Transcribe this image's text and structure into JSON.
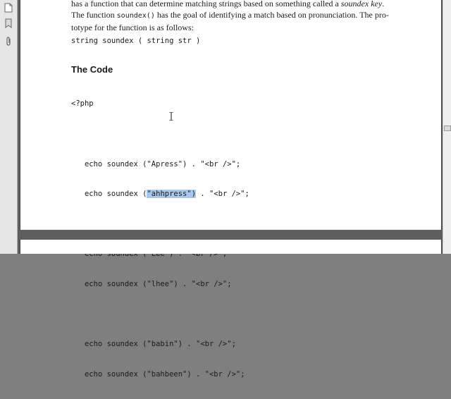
{
  "toolbar": {
    "icons": [
      "pages-icon",
      "bookmark-icon",
      "attachment-icon"
    ]
  },
  "document": {
    "intro_line1": "has a function that can determine matching strings based on something called a ",
    "intro_line1_em": "soundex key",
    "intro_line1_end": ".",
    "intro_line2_start": "The function ",
    "intro_line2_code": "soundex()",
    "intro_line2_end": " has the goal of identifying a match based on pronunciation. The pro-",
    "intro_line3": "totype for the function is as follows:",
    "prototype": "string soundex ( string str )",
    "heading": "The Code",
    "code_open": "<?php",
    "code_lines": [
      "   echo soundex (\"Apress\") . \"<br />\";",
      "   echo soundex (\"ahhpress\") . \"<br />\";",
      "",
      "   echo soundex (\"Lee\") . \"<br />\";",
      "   echo soundex (\"lhee\") . \"<br />\";",
      "",
      "   echo soundex (\"babin\") . \"<br />\";",
      "   echo soundex (\"bahbeen\") . \"<br />\";"
    ],
    "selected_text": "ahhpress\")"
  },
  "colors": {
    "selection": "#a9c7ea",
    "viewer_bg": "#5e5e5e"
  }
}
